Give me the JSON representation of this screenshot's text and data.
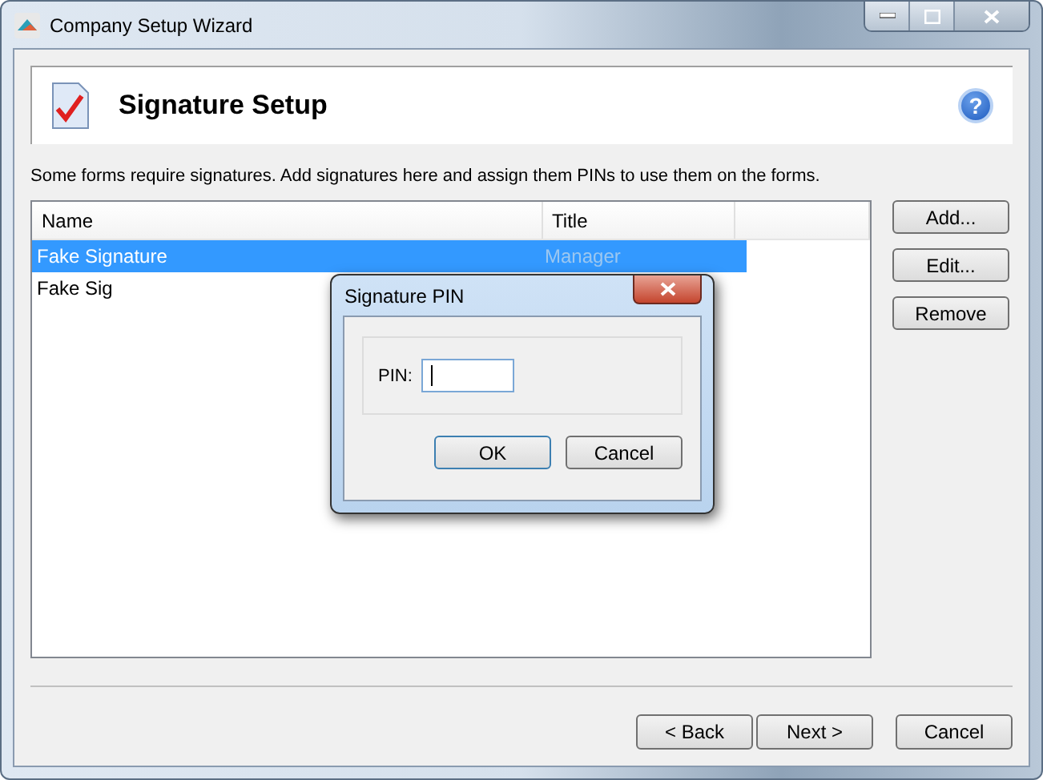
{
  "window": {
    "title": "Company Setup Wizard"
  },
  "header": {
    "title": "Signature Setup",
    "help": "?"
  },
  "description": "Some forms require signatures. Add signatures here and assign them PINs to use them on the forms.",
  "table": {
    "columns": [
      "Name",
      "Title"
    ],
    "rows": [
      {
        "name": "Fake Signature",
        "title": "Manager",
        "selected": true
      },
      {
        "name": "Fake Sig",
        "selected": false
      }
    ]
  },
  "side_buttons": [
    "Add...",
    "Edit...",
    "Remove"
  ],
  "footer_buttons": [
    "< Back",
    "Next >",
    "Cancel"
  ],
  "dialog": {
    "title": "Signature PIN",
    "field_label": "PIN:",
    "buttons": [
      "OK",
      "Cancel"
    ]
  }
}
